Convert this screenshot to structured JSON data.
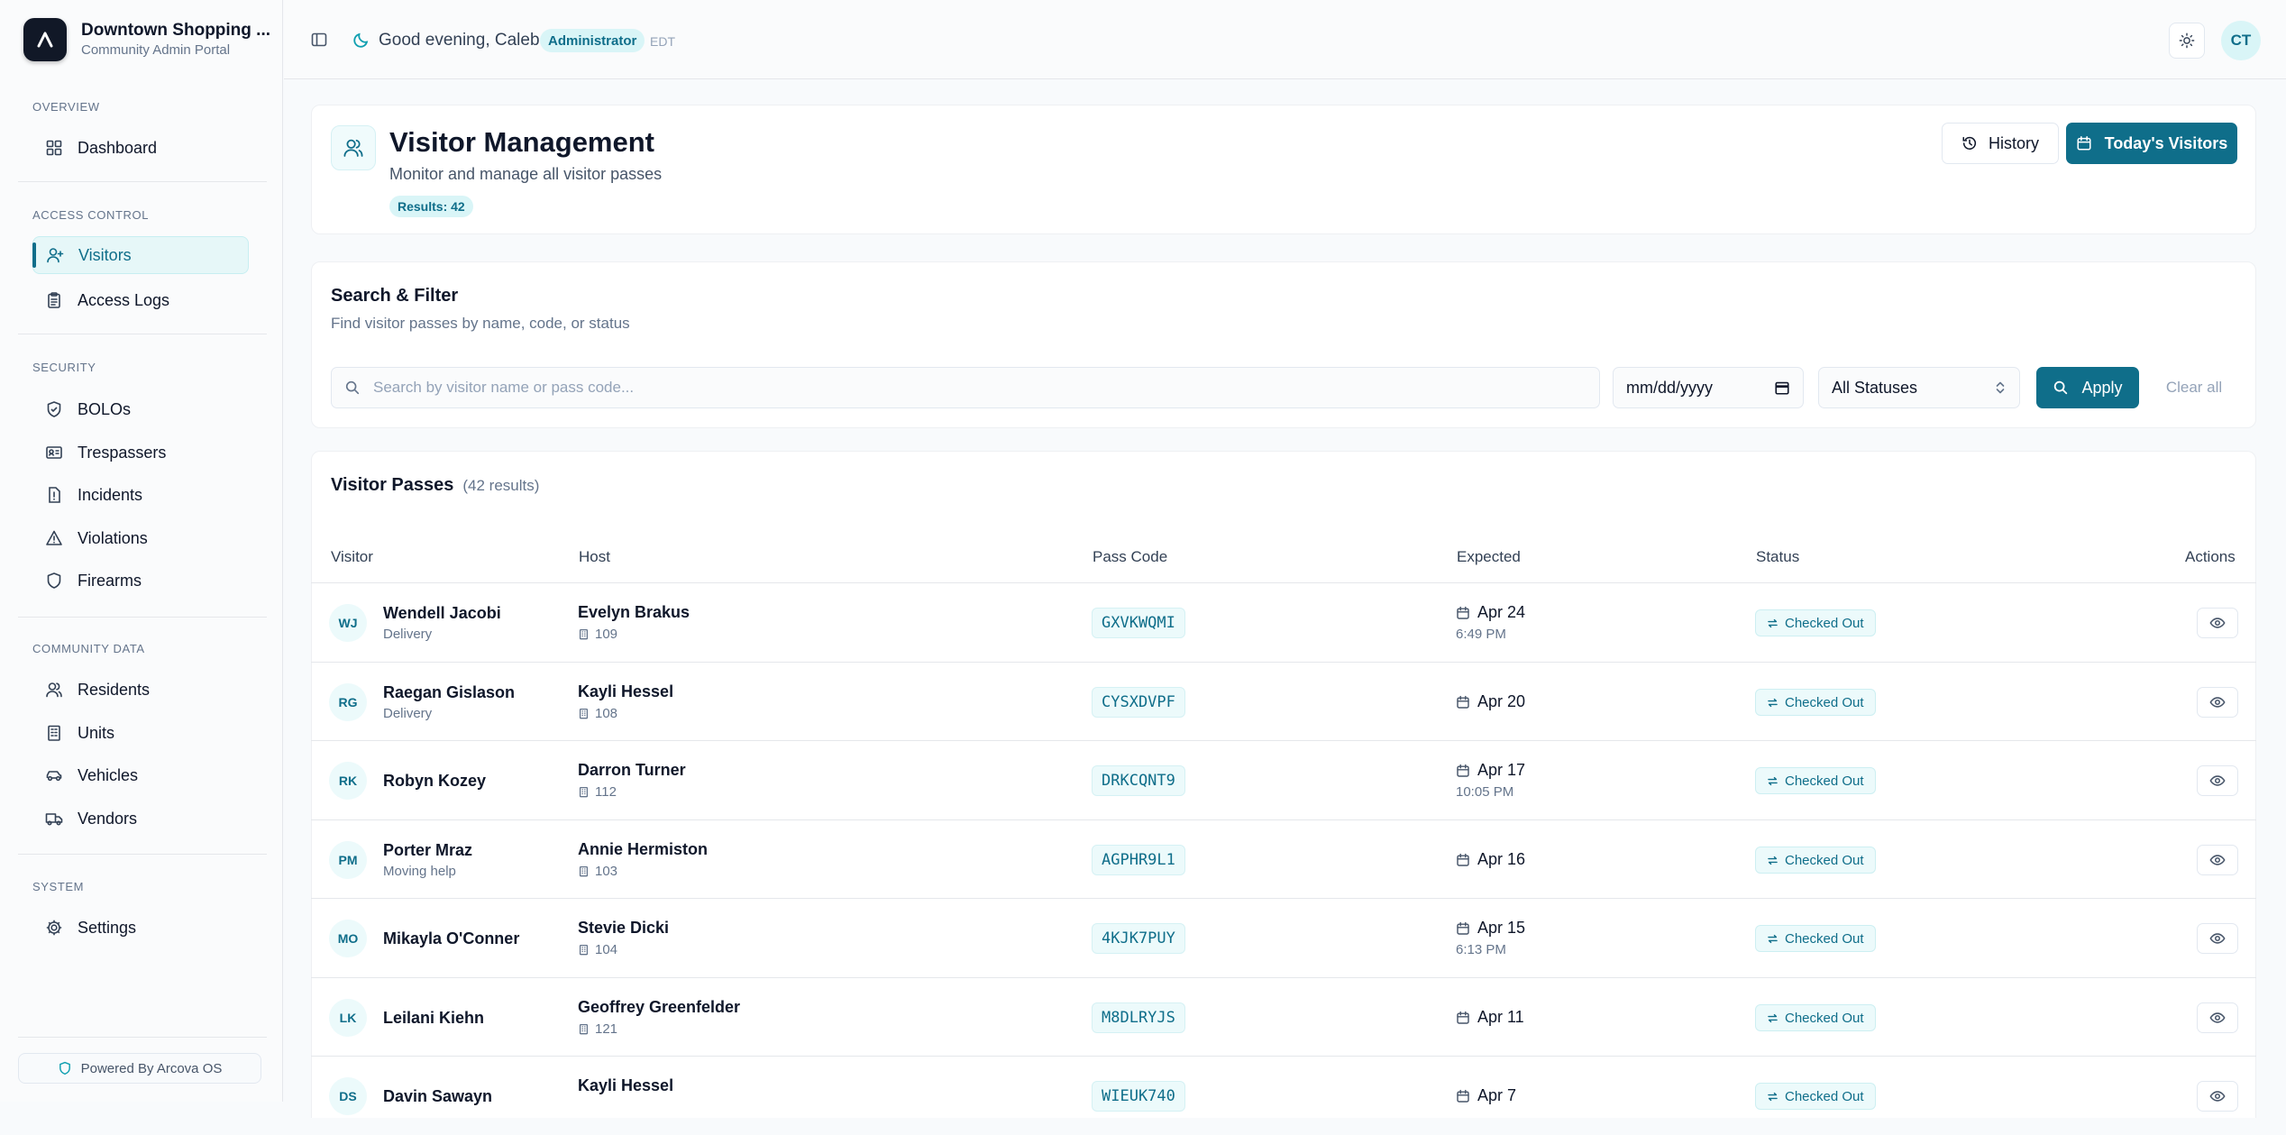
{
  "brand": {
    "logo": "A",
    "name": "Downtown Shopping ...",
    "subtitle": "Community Admin Portal"
  },
  "sidebar": {
    "sections": [
      {
        "label": "OVERVIEW",
        "items": [
          {
            "label": "Dashboard",
            "icon": "grid-icon"
          }
        ]
      },
      {
        "label": "ACCESS CONTROL",
        "items": [
          {
            "label": "Visitors",
            "icon": "user-plus-icon",
            "active": true
          },
          {
            "label": "Access Logs",
            "icon": "clipboard-icon"
          }
        ]
      },
      {
        "label": "SECURITY",
        "items": [
          {
            "label": "BOLOs",
            "icon": "shield-icon"
          },
          {
            "label": "Trespassers",
            "icon": "id-card-icon"
          },
          {
            "label": "Incidents",
            "icon": "file-alert-icon"
          },
          {
            "label": "Violations",
            "icon": "warning-icon"
          },
          {
            "label": "Firearms",
            "icon": "shield-check-icon"
          }
        ]
      },
      {
        "label": "COMMUNITY DATA",
        "items": [
          {
            "label": "Residents",
            "icon": "users-icon"
          },
          {
            "label": "Units",
            "icon": "building-icon"
          },
          {
            "label": "Vehicles",
            "icon": "car-icon"
          },
          {
            "label": "Vendors",
            "icon": "truck-icon"
          }
        ]
      },
      {
        "label": "SYSTEM",
        "items": [
          {
            "label": "Settings",
            "icon": "gear-icon"
          }
        ]
      }
    ],
    "powered_by": "Powered By Arcova OS"
  },
  "topbar": {
    "greeting": "Good evening, Caleb",
    "role": "Administrator",
    "timezone": "EDT",
    "avatar_initials": "CT"
  },
  "page": {
    "title": "Visitor Management",
    "subtitle": "Monitor and manage all visitor passes",
    "results_badge": "Results: 42",
    "history_label": "History",
    "today_label": "Today's Visitors"
  },
  "filter": {
    "title": "Search & Filter",
    "subtitle": "Find visitor passes by name, code, or status",
    "search_placeholder": "Search by visitor name or pass code...",
    "date_placeholder": "mm/dd/yyyy",
    "status_value": "All Statuses",
    "apply_label": "Apply",
    "clear_label": "Clear all"
  },
  "table": {
    "title": "Visitor Passes",
    "count_label": "(42 results)",
    "columns": [
      "Visitor",
      "Host",
      "Pass Code",
      "Expected",
      "Status",
      "Actions"
    ],
    "rows": [
      {
        "initials": "WJ",
        "visitor": "Wendell Jacobi",
        "purpose": "Delivery",
        "host": "Evelyn Brakus",
        "unit": "109",
        "code": "GXVKWQMI",
        "date": "Apr 24",
        "time": "6:49 PM",
        "status": "Checked Out"
      },
      {
        "initials": "RG",
        "visitor": "Raegan Gislason",
        "purpose": "Delivery",
        "host": "Kayli Hessel",
        "unit": "108",
        "code": "CYSXDVPF",
        "date": "Apr 20",
        "time": "",
        "status": "Checked Out"
      },
      {
        "initials": "RK",
        "visitor": "Robyn Kozey",
        "purpose": "",
        "host": "Darron Turner",
        "unit": "112",
        "code": "DRKCQNT9",
        "date": "Apr 17",
        "time": "10:05 PM",
        "status": "Checked Out"
      },
      {
        "initials": "PM",
        "visitor": "Porter Mraz",
        "purpose": "Moving help",
        "host": "Annie Hermiston",
        "unit": "103",
        "code": "AGPHR9L1",
        "date": "Apr 16",
        "time": "",
        "status": "Checked Out"
      },
      {
        "initials": "MO",
        "visitor": "Mikayla O'Conner",
        "purpose": "",
        "host": "Stevie Dicki",
        "unit": "104",
        "code": "4KJK7PUY",
        "date": "Apr 15",
        "time": "6:13 PM",
        "status": "Checked Out"
      },
      {
        "initials": "LK",
        "visitor": "Leilani Kiehn",
        "purpose": "",
        "host": "Geoffrey Greenfelder",
        "unit": "121",
        "code": "M8DLRYJS",
        "date": "Apr 11",
        "time": "",
        "status": "Checked Out"
      },
      {
        "initials": "DS",
        "visitor": "Davin Sawayn",
        "purpose": "",
        "host": "Kayli Hessel",
        "unit": "",
        "code": "WIEUK740",
        "date": "Apr 7",
        "time": "",
        "status": "Checked Out"
      }
    ]
  },
  "colors": {
    "accent": "#0f6e8a",
    "accent_light": "#ecfafb"
  }
}
